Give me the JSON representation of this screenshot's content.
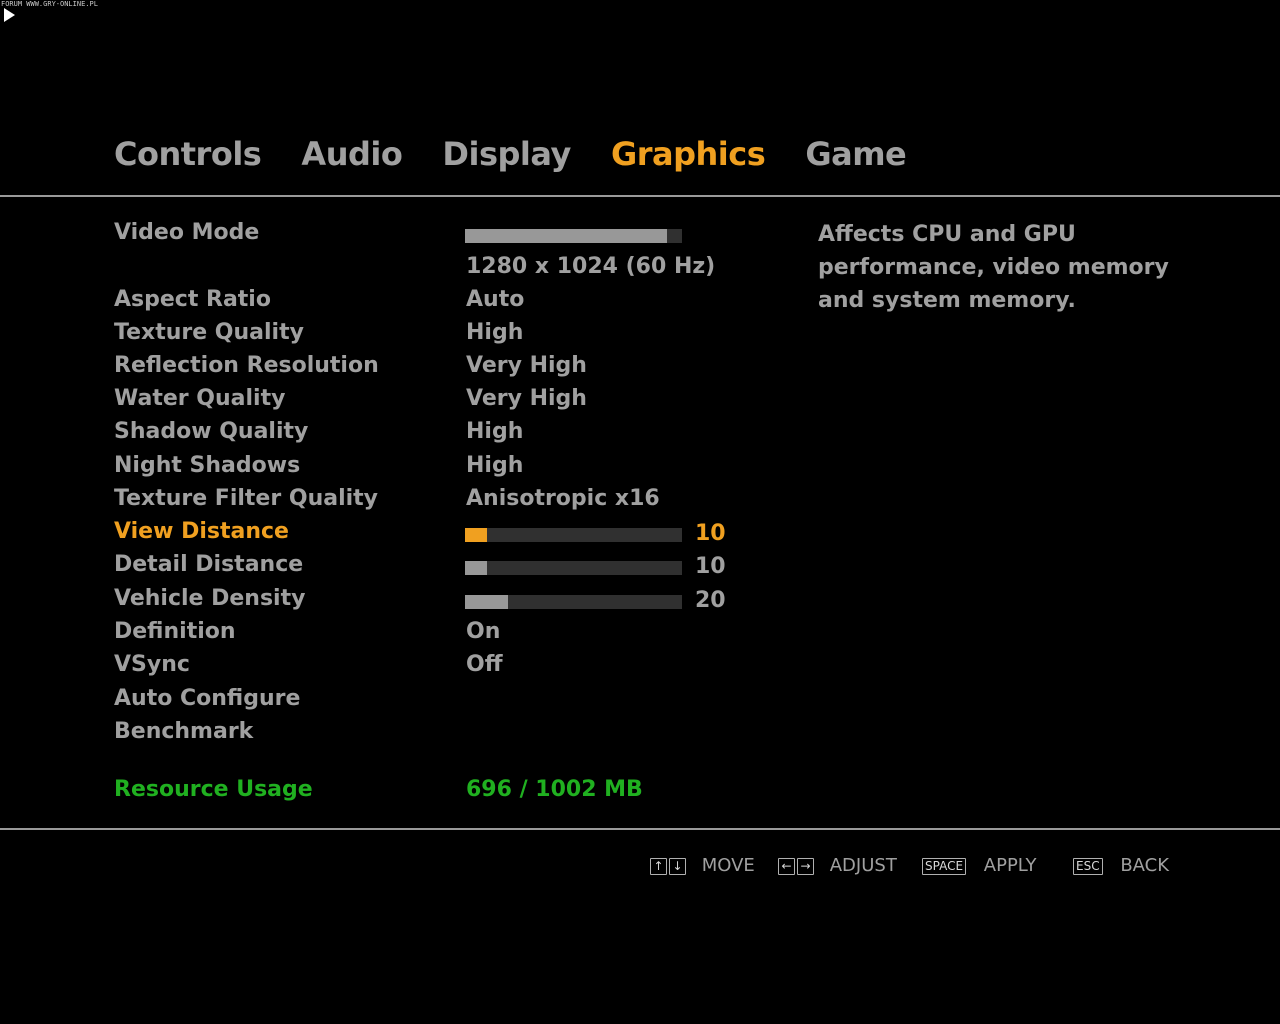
{
  "watermark": "FORUM WWW.GRY-ONLINE.PL",
  "tabs": [
    {
      "label": "Controls"
    },
    {
      "label": "Audio"
    },
    {
      "label": "Display"
    },
    {
      "label": "Graphics"
    },
    {
      "label": "Game"
    }
  ],
  "active_tab": "Graphics",
  "settings": {
    "video_mode": {
      "label": "Video Mode",
      "value": "1280 x 1024 (60 Hz)",
      "bar_fraction": 0.93
    },
    "aspect_ratio": {
      "label": "Aspect Ratio",
      "value": "Auto"
    },
    "texture_quality": {
      "label": "Texture Quality",
      "value": "High"
    },
    "reflection_resolution": {
      "label": "Reflection Resolution",
      "value": "Very High"
    },
    "water_quality": {
      "label": "Water Quality",
      "value": "Very High"
    },
    "shadow_quality": {
      "label": "Shadow Quality",
      "value": "High"
    },
    "night_shadows": {
      "label": "Night Shadows",
      "value": "High"
    },
    "texture_filter_quality": {
      "label": "Texture Filter Quality",
      "value": "Anisotropic x16"
    },
    "view_distance": {
      "label": "View Distance",
      "value": "10",
      "bar_fraction": 0.1
    },
    "detail_distance": {
      "label": "Detail Distance",
      "value": "10",
      "bar_fraction": 0.1
    },
    "vehicle_density": {
      "label": "Vehicle Density",
      "value": "20",
      "bar_fraction": 0.2
    },
    "definition": {
      "label": "Definition",
      "value": "On"
    },
    "vsync": {
      "label": "VSync",
      "value": "Off"
    },
    "auto_configure": {
      "label": "Auto Configure"
    },
    "benchmark": {
      "label": "Benchmark"
    }
  },
  "resource_usage": {
    "label": "Resource Usage",
    "value": "696 / 1002 MB"
  },
  "description": "Affects CPU and GPU performance, video memory and system memory.",
  "footer": {
    "move": {
      "keys": [
        "↑",
        "↓"
      ],
      "label": "MOVE"
    },
    "adjust": {
      "keys": [
        "←",
        "→"
      ],
      "label": "ADJUST"
    },
    "apply": {
      "key": "SPACE",
      "label": "APPLY"
    },
    "back": {
      "key": "ESC",
      "label": "BACK"
    }
  },
  "colors": {
    "active": "#f0a020",
    "normal": "#a0a0a0",
    "resource": "#20b020",
    "background": "#000000"
  }
}
